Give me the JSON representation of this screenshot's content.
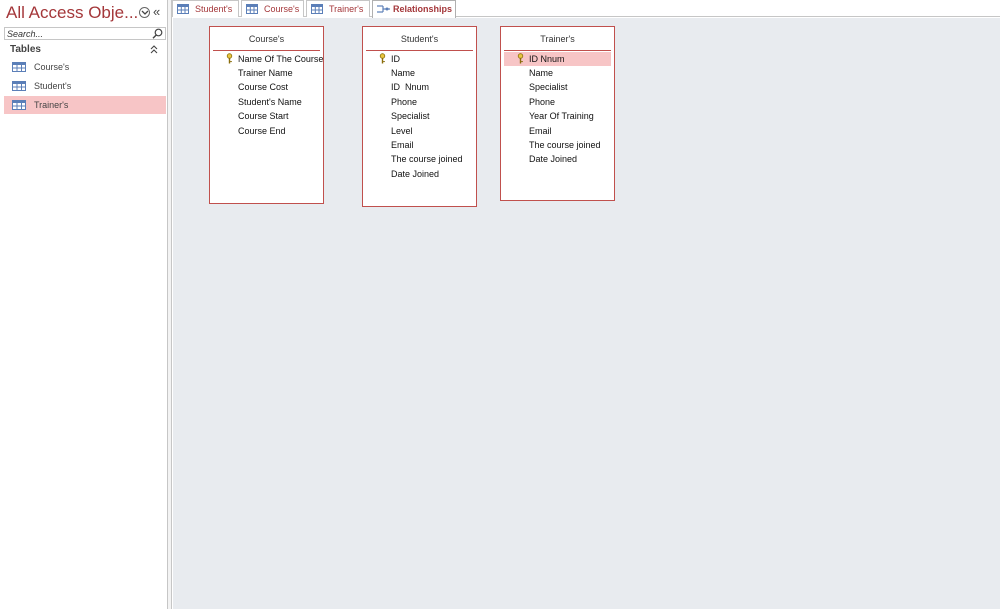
{
  "nav": {
    "title": "All Access Obje...",
    "collapse_glyph": "«",
    "search_placeholder": "Search...",
    "group_label": "Tables",
    "items": [
      {
        "label": "Course's",
        "icon": "table-icon",
        "selected": false
      },
      {
        "label": "Student's",
        "icon": "table-icon",
        "selected": false
      },
      {
        "label": "Trainer's",
        "icon": "table-icon",
        "selected": true
      }
    ]
  },
  "tabs": [
    {
      "label": "Student's",
      "icon": "table-icon",
      "active": false
    },
    {
      "label": "Course's",
      "icon": "table-icon",
      "active": false
    },
    {
      "label": "Trainer's",
      "icon": "table-icon",
      "active": false
    },
    {
      "label": "Relationships",
      "icon": "relationships-icon",
      "active": true
    }
  ],
  "tables": [
    {
      "title": "Course's",
      "fields": [
        {
          "name": "Name Of The Course",
          "key": true
        },
        {
          "name": "Trainer Name",
          "key": false
        },
        {
          "name": "Course Cost",
          "key": false
        },
        {
          "name": "Student's Name",
          "key": false
        },
        {
          "name": "Course Start",
          "key": false
        },
        {
          "name": "Course End",
          "key": false
        }
      ]
    },
    {
      "title": "Student's",
      "fields": [
        {
          "name": "ID",
          "key": true
        },
        {
          "name": "Name",
          "key": false
        },
        {
          "name": "ID  Nnum",
          "key": false
        },
        {
          "name": "Phone",
          "key": false
        },
        {
          "name": "Specialist",
          "key": false
        },
        {
          "name": "Level",
          "key": false
        },
        {
          "name": "Email",
          "key": false
        },
        {
          "name": "The course joined",
          "key": false
        },
        {
          "name": "Date Joined",
          "key": false
        }
      ]
    },
    {
      "title": "Trainer's",
      "fields": [
        {
          "name": "ID Nnum",
          "key": true,
          "selected": true
        },
        {
          "name": "Name",
          "key": false
        },
        {
          "name": "Specialist",
          "key": false
        },
        {
          "name": "Phone",
          "key": false
        },
        {
          "name": "Year Of Training",
          "key": false
        },
        {
          "name": "Email",
          "key": false
        },
        {
          "name": "The course joined",
          "key": false
        },
        {
          "name": "Date Joined",
          "key": false
        }
      ]
    }
  ],
  "colors": {
    "accent": "#a4373a",
    "table_border": "#c0504d",
    "selection": "#f7c5c6",
    "canvas": "#e8ebef"
  }
}
